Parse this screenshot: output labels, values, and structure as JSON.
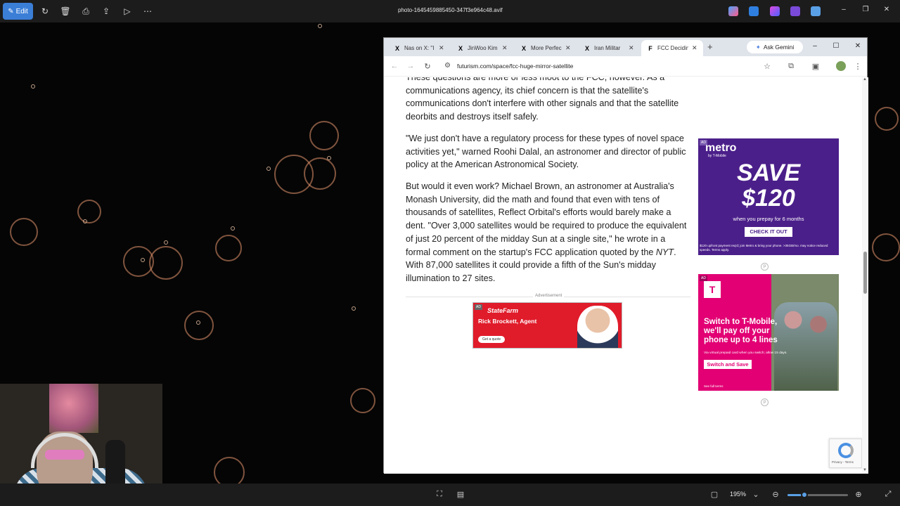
{
  "viewer": {
    "edit_label": "Edit",
    "filename": "photo-1645459885450-347f3e964c48.avif",
    "zoom": "195%",
    "zoom_level": 0.28
  },
  "browser": {
    "tabs": [
      {
        "label": "Nas on X: \"I",
        "icon": "x-logo-icon",
        "active": false
      },
      {
        "label": "JinWoo Kim",
        "icon": "x-logo-icon",
        "active": false
      },
      {
        "label": "More Perfec",
        "icon": "x-logo-icon",
        "active": false
      },
      {
        "label": "Iran Militar",
        "icon": "x-logo-icon",
        "active": false
      },
      {
        "label": "FCC Decidin",
        "icon": "futurism-icon",
        "active": true
      }
    ],
    "ask_gemini": "Ask Gemini",
    "url": "futurism.com/space/fcc-huge-mirror-satellite"
  },
  "article": {
    "p1": "These questions are more or less moot to the FCC, however. As a communications agency, its chief concern is that the satellite's communications don't interfere with other signals and that the satellite deorbits and destroys itself safely.",
    "p2": " \"We just don't have a regulatory process for these types of novel space activities yet,\" warned Roohi Dalal, an astronomer and director of public policy at the American Astronomical Society.",
    "p3_a": "But would it even work? Michael Brown, an astronomer at Australia's Monash University, did the math and found that even with tens of thousands of satellites, Reflect Orbital's efforts would barely make a dent. \"Over 3,000 satellites would be required to produce the equivalent of just 20 percent of the midday Sun at a single site,\" he wrote in a formal comment on the startup's FCC application quoted by the ",
    "p3_nyt": "NYT",
    "p3_b": ". With 87,000 satellites it could provide a fifth of the Sun's midday illumination to 27 sites.",
    "advertisement_label": "Advertisement"
  },
  "ads": {
    "ad_tag": "AD",
    "statefarm": {
      "brand": "StateFarm",
      "agent": "Rick Brockett, Agent",
      "cta": "Get a quote"
    },
    "metro": {
      "logo": "metro",
      "sub": "by T-Mobile",
      "headline": "SAVE",
      "amount": "$120",
      "line": "when you prepay for 6 months",
      "cta": "CHECK IT OUT",
      "fine": "$120 upfront payment req'd; join Metro & bring your phone. >35GB/mo. may notice reduced speeds. Terms apply."
    },
    "tmobile": {
      "logo": "T",
      "headline": "Switch to T-Mobile, we'll pay off your phone up to 4 lines",
      "small": "Via virtual prepaid card when you switch; allow 15 days.",
      "cta": "Switch and Save",
      "fine": "See full terms"
    }
  },
  "recaptcha": {
    "text": "Privacy - Terms"
  }
}
